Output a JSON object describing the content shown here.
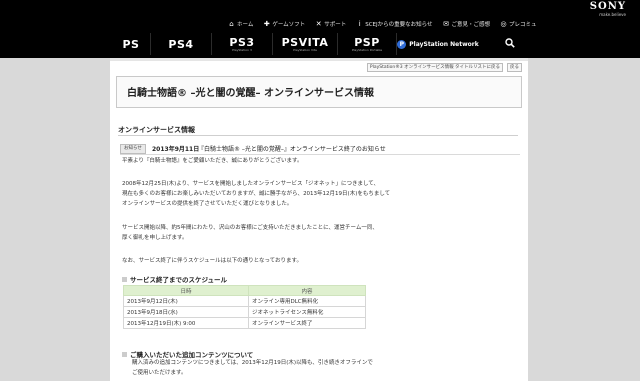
{
  "brand": {
    "name": "SONY",
    "tagline": "make.believe"
  },
  "util_nav": [
    {
      "icon": "home-icon",
      "glyph": "⌂",
      "label": "ホーム"
    },
    {
      "icon": "gamepad-icon",
      "glyph": "✚",
      "label": "ゲームソフト"
    },
    {
      "icon": "tools-icon",
      "glyph": "✕",
      "label": "サポート"
    },
    {
      "icon": "info-icon",
      "glyph": "i",
      "label": "SCEJからの重要なお知らせ"
    },
    {
      "icon": "mail-icon",
      "glyph": "✉",
      "label": "ご意見・ご感想"
    },
    {
      "icon": "globe-icon",
      "glyph": "◎",
      "label": "プレコミュ"
    }
  ],
  "platform_nav": [
    {
      "id": "ps-logo",
      "name": "PS",
      "sub": ""
    },
    {
      "id": "ps4",
      "name": "PS4",
      "sub": ""
    },
    {
      "id": "ps3",
      "name": "PS3",
      "sub": "PlayStation 3"
    },
    {
      "id": "psvita",
      "name": "PSVITA",
      "sub": "PlayStation Vita"
    },
    {
      "id": "psp",
      "name": "PSP",
      "sub": "PlayStation Portable"
    },
    {
      "id": "psn",
      "name": "PlayStation Network",
      "sub": ""
    }
  ],
  "breadcrumb": {
    "current": "PlayStation®3 オンラインサービス情報 タイトルリストに戻る",
    "back": "戻る"
  },
  "page": {
    "title": "白騎士物語® –光と闇の覚醒– オンラインサービス情報",
    "section": "オンラインサービス情報"
  },
  "news": {
    "badge": "お知らせ",
    "date": "2013年9月11日",
    "title": "『白騎士物語® –光と闇の覚醒–』オンラインサービス終了のお知らせ",
    "paragraphs": [
      "平素より『白騎士物語』をご愛顧いただき、誠にありがとうございます。",
      "2008年12月25日(木)より、サービスを開始しましたオンラインサービス「ジオネット」につきまして、",
      "現在も多くのお客様にお楽しみいただいておりますが、誠に勝手ながら、2013年12月19日(木)をもちまして",
      "オンラインサービスの提供を終了させていただく運びとなりました。",
      "サービス開始以降、約5年間にわたり、沢山のお客様にご支持いただきましたことに、運営チーム一同、",
      "厚く御礼を申し上げます。",
      "なお、サービス終了に伴うスケジュールは以下の通りとなっております。"
    ]
  },
  "schedule": {
    "heading": "サービス終了までのスケジュール",
    "columns": [
      "日時",
      "内容"
    ],
    "rows": [
      [
        "2013年9月12日(木)",
        "オンライン専用DLC無料化"
      ],
      [
        "2013年9月18日(水)",
        "ジオネットライセンス無料化"
      ],
      [
        "2013年12月19日(木) 9:00",
        "オンラインサービス終了"
      ]
    ]
  },
  "dlc": {
    "heading": "ご購入いただいた追加コンテンツについて",
    "lines": [
      "購入済みの追加コンテンツにつきましては、2013年12月19日(木)以降も、引き続きオフラインで",
      "ご使用いただけます。"
    ]
  }
}
